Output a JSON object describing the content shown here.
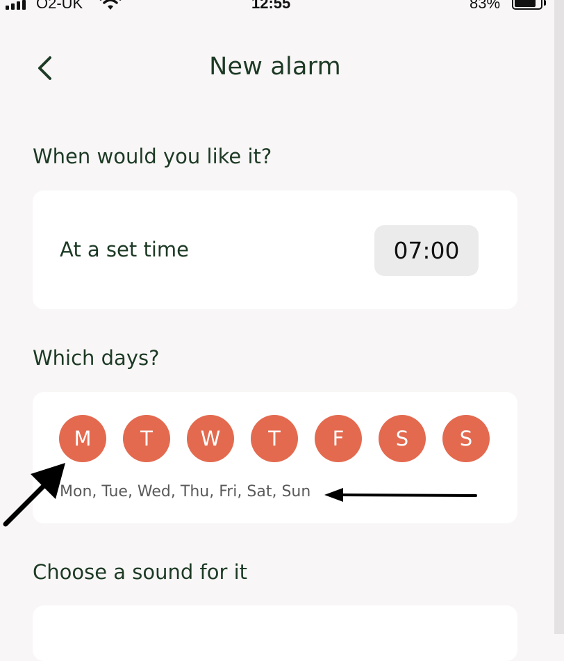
{
  "status_bar": {
    "carrier": "O2-UK",
    "time": "12:55",
    "battery": "83%",
    "battery_level": 0.83,
    "icons": [
      "signal-icon",
      "wifi-icon",
      "battery-icon"
    ]
  },
  "header": {
    "title": "New alarm",
    "back_icon": "chevron-left-icon"
  },
  "sections": {
    "when_heading": "When would you like it?",
    "time_label": "At a set time",
    "time_value": "07:00",
    "days_heading": "Which days?",
    "days": [
      {
        "letter": "M",
        "selected": true
      },
      {
        "letter": "T",
        "selected": true
      },
      {
        "letter": "W",
        "selected": true
      },
      {
        "letter": "T",
        "selected": true
      },
      {
        "letter": "F",
        "selected": true
      },
      {
        "letter": "S",
        "selected": true
      },
      {
        "letter": "S",
        "selected": true
      }
    ],
    "days_summary": "Mon, Tue, Wed, Thu, Fri, Sat, Sun",
    "sound_heading": "Choose a sound for it"
  },
  "colors": {
    "background": "#f8f6f6",
    "heading_text": "#1d3a25",
    "day_selected": "#e36a4f",
    "card": "#ffffff",
    "time_pill": "#ebebeb"
  }
}
